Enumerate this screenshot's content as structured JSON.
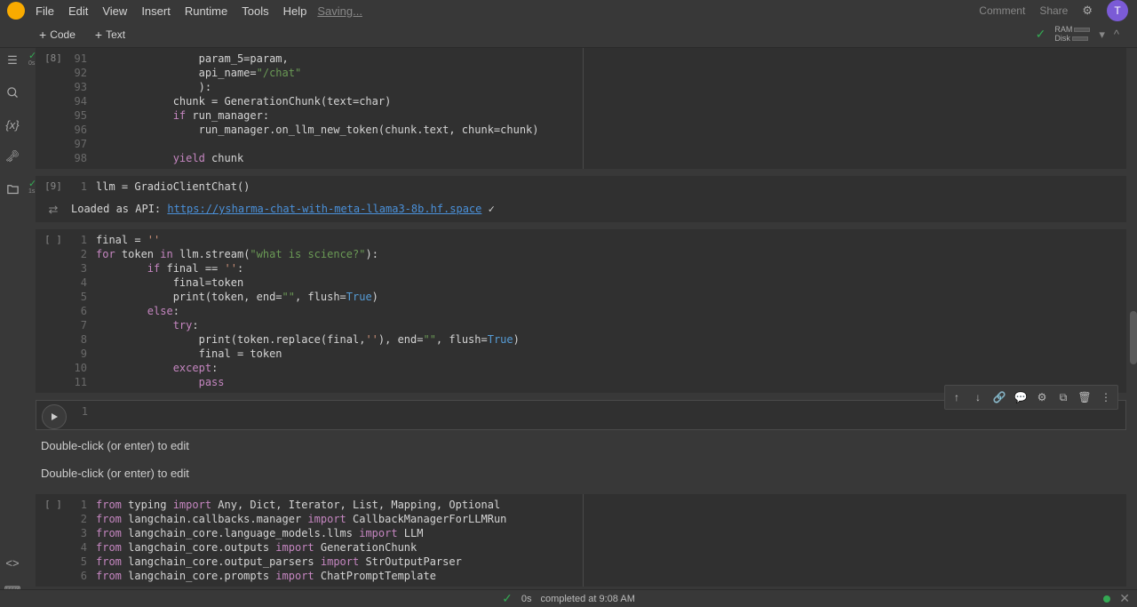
{
  "menus": [
    "File",
    "Edit",
    "View",
    "Insert",
    "Runtime",
    "Tools",
    "Help"
  ],
  "saving_label": "Saving...",
  "top_right": {
    "comment": "Comment",
    "share": "Share",
    "avatar_letter": "T"
  },
  "toolbar": {
    "code": "Code",
    "text": "Text",
    "ram": "RAM",
    "disk": "Disk"
  },
  "cells": {
    "cell8": {
      "exec": "[8]",
      "time": "0s",
      "lines": [
        {
          "n": "91",
          "tokens": [
            [
              "var",
              "                param_5=param,"
            ]
          ]
        },
        {
          "n": "92",
          "tokens": [
            [
              "var",
              "                api_name="
            ],
            [
              "str",
              "\"/chat\""
            ]
          ]
        },
        {
          "n": "93",
          "tokens": [
            [
              "var",
              "                ):"
            ]
          ]
        },
        {
          "n": "94",
          "tokens": [
            [
              "var",
              "            chunk = GenerationChunk(text=char)"
            ]
          ]
        },
        {
          "n": "95",
          "tokens": [
            [
              "var",
              "            "
            ],
            [
              "kw",
              "if"
            ],
            [
              "var",
              " run_manager:"
            ]
          ]
        },
        {
          "n": "96",
          "tokens": [
            [
              "var",
              "                run_manager.on_llm_new_token(chunk.text, chunk=chunk)"
            ]
          ]
        },
        {
          "n": "97",
          "tokens": [
            [
              "var",
              ""
            ]
          ]
        },
        {
          "n": "98",
          "tokens": [
            [
              "var",
              "            "
            ],
            [
              "kw",
              "yield"
            ],
            [
              "var",
              " chunk"
            ]
          ]
        }
      ]
    },
    "cell9": {
      "exec": "[9]",
      "time": "1s",
      "lines": [
        {
          "n": "1",
          "tokens": [
            [
              "var",
              "llm = GradioClientChat()"
            ]
          ]
        }
      ],
      "output": {
        "prefix": "Loaded as API: ",
        "url": "https://ysharma-chat-with-meta-llama3-8b.hf.space",
        "suffix": " ✓"
      }
    },
    "cell_stream": {
      "exec": "[ ]",
      "lines": [
        {
          "n": "1",
          "tokens": [
            [
              "var",
              "final = "
            ],
            [
              "str2",
              "''"
            ]
          ]
        },
        {
          "n": "2",
          "tokens": [
            [
              "kw",
              "for"
            ],
            [
              "var",
              " token "
            ],
            [
              "kw",
              "in"
            ],
            [
              "var",
              " llm.stream("
            ],
            [
              "str",
              "\"what is science?\""
            ],
            [
              "var",
              "):"
            ]
          ]
        },
        {
          "n": "3",
          "tokens": [
            [
              "var",
              "        "
            ],
            [
              "kw",
              "if"
            ],
            [
              "var",
              " final == "
            ],
            [
              "str2",
              "''"
            ],
            [
              "var",
              ":"
            ]
          ]
        },
        {
          "n": "4",
          "tokens": [
            [
              "var",
              "            final=token"
            ]
          ]
        },
        {
          "n": "5",
          "tokens": [
            [
              "var",
              "            print(token, end="
            ],
            [
              "str",
              "\"\""
            ],
            [
              "var",
              ", flush="
            ],
            [
              "bool",
              "True"
            ],
            [
              "var",
              ")"
            ]
          ]
        },
        {
          "n": "6",
          "tokens": [
            [
              "var",
              "        "
            ],
            [
              "kw",
              "else"
            ],
            [
              "var",
              ":"
            ]
          ]
        },
        {
          "n": "7",
          "tokens": [
            [
              "var",
              "            "
            ],
            [
              "kw",
              "try"
            ],
            [
              "var",
              ":"
            ]
          ]
        },
        {
          "n": "8",
          "tokens": [
            [
              "var",
              "                print(token.replace(final,"
            ],
            [
              "str2",
              "''"
            ],
            [
              "var",
              "), end="
            ],
            [
              "str",
              "\"\""
            ],
            [
              "var",
              ", flush="
            ],
            [
              "bool",
              "True"
            ],
            [
              "var",
              ")"
            ]
          ]
        },
        {
          "n": "9",
          "tokens": [
            [
              "var",
              "                final = token"
            ]
          ]
        },
        {
          "n": "10",
          "tokens": [
            [
              "var",
              "            "
            ],
            [
              "kw",
              "except"
            ],
            [
              "var",
              ":"
            ]
          ]
        },
        {
          "n": "11",
          "tokens": [
            [
              "var",
              "                "
            ],
            [
              "kw",
              "pass"
            ]
          ]
        }
      ]
    },
    "active": {
      "lines": [
        {
          "n": "1",
          "tokens": [
            [
              "var",
              ""
            ]
          ]
        }
      ]
    },
    "cell_imports": {
      "exec": "[ ]",
      "lines": [
        {
          "n": "1",
          "tokens": [
            [
              "kw",
              "from"
            ],
            [
              "var",
              " typing "
            ],
            [
              "kw",
              "import"
            ],
            [
              "var",
              " Any, Dict, Iterator, List, Mapping, Optional"
            ]
          ]
        },
        {
          "n": "2",
          "tokens": [
            [
              "kw",
              "from"
            ],
            [
              "var",
              " langchain.callbacks.manager "
            ],
            [
              "kw",
              "import"
            ],
            [
              "var",
              " CallbackManagerForLLMRun"
            ]
          ]
        },
        {
          "n": "3",
          "tokens": [
            [
              "kw",
              "from"
            ],
            [
              "var",
              " langchain_core.language_models.llms "
            ],
            [
              "kw",
              "import"
            ],
            [
              "var",
              " LLM"
            ]
          ]
        },
        {
          "n": "4",
          "tokens": [
            [
              "kw",
              "from"
            ],
            [
              "var",
              " langchain_core.outputs "
            ],
            [
              "kw",
              "import"
            ],
            [
              "var",
              " GenerationChunk"
            ]
          ]
        },
        {
          "n": "5",
          "tokens": [
            [
              "kw",
              "from"
            ],
            [
              "var",
              " langchain_core.output_parsers "
            ],
            [
              "kw",
              "import"
            ],
            [
              "var",
              " StrOutputParser"
            ]
          ]
        },
        {
          "n": "6",
          "tokens": [
            [
              "kw",
              "from"
            ],
            [
              "var",
              " langchain_core.prompts "
            ],
            [
              "kw",
              "import"
            ],
            [
              "var",
              " ChatPromptTemplate"
            ]
          ]
        }
      ]
    }
  },
  "markdown_placeholder": "Double-click (or enter) to edit",
  "status": {
    "dur": "0s",
    "completed": "completed at 9:08 AM"
  }
}
